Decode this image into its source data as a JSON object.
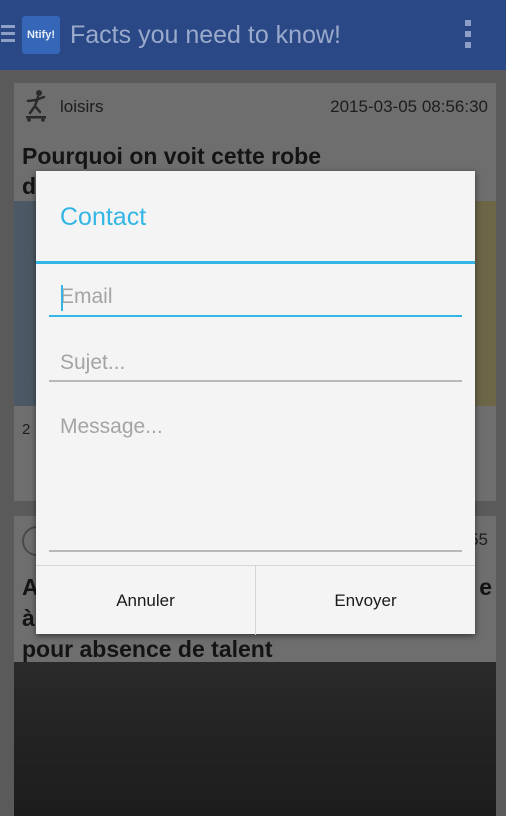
{
  "app": {
    "logo_text": "Ntify!",
    "title": "Facts you need to know!"
  },
  "feed": {
    "cards": [
      {
        "category": "loisirs",
        "date": "2015-03-05 08:56:30",
        "title": "Pourquoi on voit cette robe",
        "title_overflow": "d",
        "count": "2",
        "icon": "skateboarder-icon"
      },
      {
        "date_partial": "55",
        "title_line1_start": "A",
        "title_line1_end": "e",
        "title_line2_start": "à",
        "title_line3": "pour absence de talent",
        "icon": "circle-icon"
      }
    ]
  },
  "dialog": {
    "title": "Contact",
    "email_placeholder": "Email",
    "subject_placeholder": "Sujet...",
    "message_placeholder": "Message...",
    "cancel_label": "Annuler",
    "send_label": "Envoyer"
  },
  "colors": {
    "accent": "#33b5e5",
    "actionbar": "#2a4886"
  }
}
